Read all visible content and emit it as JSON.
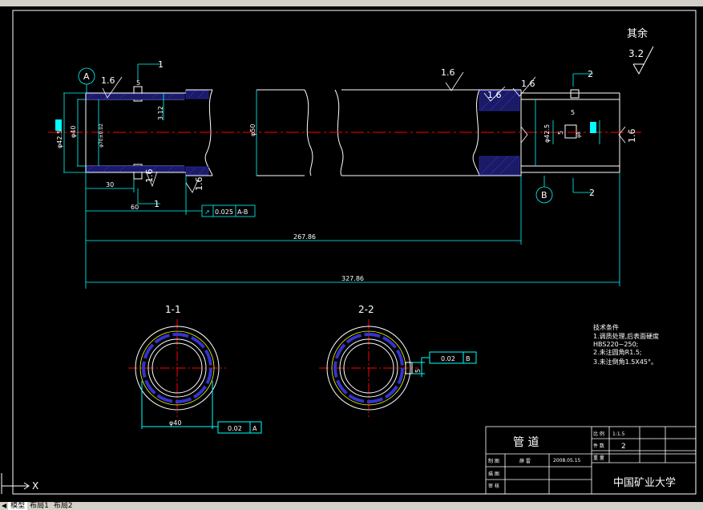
{
  "colors": {
    "background": "#000000",
    "outline": "#ffffff",
    "dimension": "#00ffff",
    "centerline": "#ff0000",
    "hatch": "#3333cc",
    "highlight": "#00ffff"
  },
  "toolbar_icons": [
    "toolbar-button-icons"
  ],
  "drawing": {
    "roughness_note": "其余",
    "roughness_value": "3.2",
    "roughness_marks": [
      "1.6",
      "1.6",
      "1.6",
      "1.6",
      "1.6",
      "1.6",
      "1.6"
    ],
    "datum_a": "A",
    "datum_b": "B",
    "section_marks": [
      "1",
      "1",
      "2",
      "2"
    ],
    "dims": {
      "d_425": "φ42.5",
      "d_40": "φ40",
      "d_50": "φ50",
      "d_425_right": "φ42.5",
      "keyway_depth": "3.12",
      "keyway_w": "5",
      "keyway_w_right": "5",
      "keyway_right_len": "5",
      "tol_hole": "φ70±0.02",
      "small_right": "φ8",
      "len_30": "30",
      "len_60": "60",
      "len_267": "267.86",
      "len_327": "327.86",
      "sec_d40": "φ40",
      "sec_5": "5"
    },
    "tolerances": {
      "runout_a": {
        "symbol": "↗",
        "value": "0.025",
        "datum": "A-B"
      },
      "sec1": {
        "value": "0.02",
        "datum": "A"
      },
      "sec2": {
        "value": "0.02",
        "datum": "B"
      }
    },
    "section_labels": {
      "s1": "1-1",
      "s2": "2-2"
    },
    "tech_requirements": {
      "title": "技术条件",
      "items": [
        "1.调质处理,后表面硬度",
        "HBS220~250;",
        "2.未注圆角R1.5;",
        "3.未注倒角1.5X45°。"
      ]
    },
    "title_block": {
      "part_name": "管  道",
      "scale_label": "比 例",
      "scale_value": "1:1.5",
      "count_label": "件 数",
      "count_value": "2",
      "weight_label": "重 量",
      "drawn_label": "制 图",
      "drawn_name": "薛 雷",
      "drawn_date": "2008.05.15",
      "draft_label": "描 图",
      "review_label": "审 核",
      "school": "中国矿业大学"
    }
  },
  "ucs_label": "X",
  "tabs": {
    "model": "模型",
    "layout1": "布局1",
    "layout2": "布局2"
  }
}
